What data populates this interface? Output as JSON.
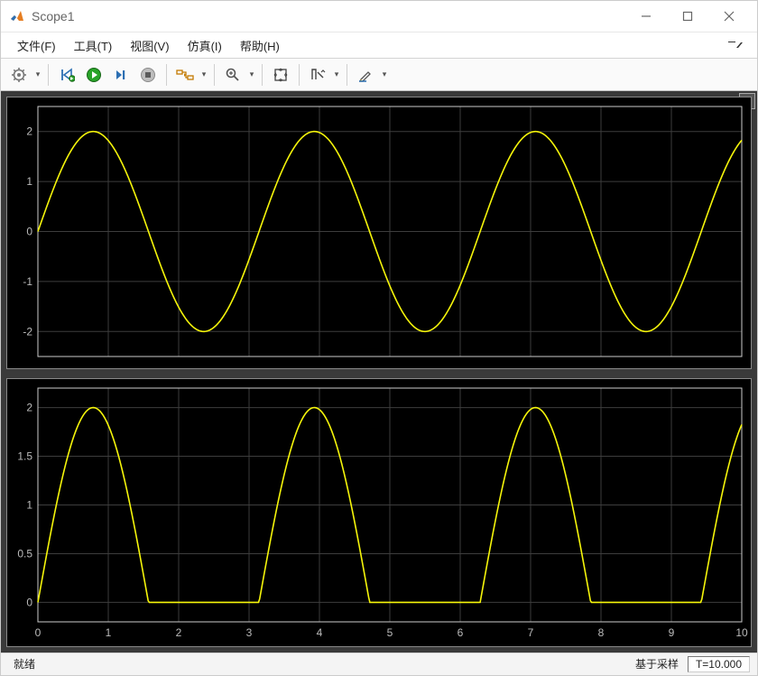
{
  "window": {
    "title": "Scope1"
  },
  "menu": {
    "file": "文件(F)",
    "tools": "工具(T)",
    "view": "视图(V)",
    "simulation": "仿真(I)",
    "help": "帮助(H)"
  },
  "toolbar": {
    "settings": "settings",
    "back": "back-to-start",
    "play": "run",
    "step": "step-forward",
    "stop": "stop",
    "signal": "signal-selector",
    "zoom": "zoom",
    "fit": "fit-to-view",
    "cursor": "cursor-measure",
    "draw": "draw"
  },
  "status": {
    "ready": "就绪",
    "sample_based": "基于采样",
    "time_label": "T=10.000"
  },
  "chart_data": [
    {
      "type": "line",
      "xlabel": "",
      "ylabel": "",
      "xlim": [
        0,
        10
      ],
      "ylim": [
        -2.5,
        2.5
      ],
      "xticks": [
        0,
        1,
        2,
        3,
        4,
        5,
        6,
        7,
        8,
        9,
        10
      ],
      "yticks": [
        -2,
        -1,
        0,
        1,
        2
      ],
      "series": [
        {
          "name": "sine",
          "color": "#f5f50a",
          "function": "2*sin(2*pi*x/(pi))",
          "amplitude": 2,
          "period": 3.1416,
          "x_range": [
            0,
            10
          ]
        }
      ]
    },
    {
      "type": "line",
      "xlabel": "",
      "ylabel": "",
      "xlim": [
        0,
        10
      ],
      "ylim": [
        -0.2,
        2.2
      ],
      "xticks": [
        0,
        1,
        2,
        3,
        4,
        5,
        6,
        7,
        8,
        9,
        10
      ],
      "yticks": [
        0,
        0.5,
        1,
        1.5,
        2
      ],
      "series": [
        {
          "name": "rectified-sine",
          "color": "#f5f50a",
          "function": "max(0, 2*sin(2*pi*x/(pi)))",
          "amplitude": 2,
          "period": 3.1416,
          "x_range": [
            0,
            10
          ]
        }
      ]
    }
  ]
}
